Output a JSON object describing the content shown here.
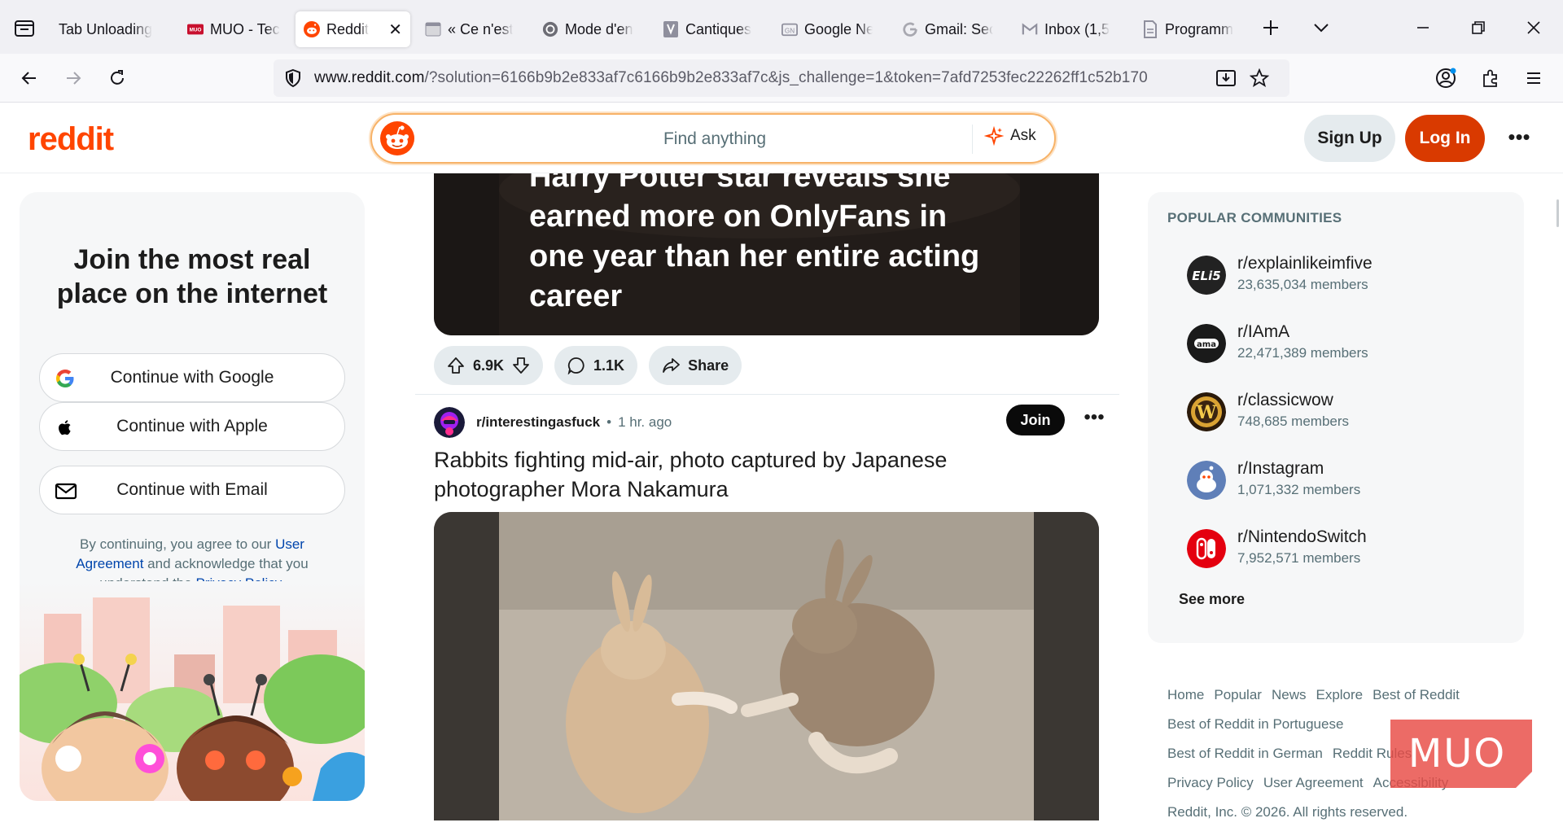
{
  "browser": {
    "tabs": [
      {
        "label": "Tab Unloading",
        "icon": "firefox-icon",
        "active": false
      },
      {
        "label": "MUO - Tec",
        "icon": "muo-icon",
        "active": false
      },
      {
        "label": "Reddit",
        "icon": "reddit-icon",
        "active": true
      },
      {
        "label": "« Ce n'est",
        "icon": "page-icon",
        "active": false
      },
      {
        "label": "Mode d'en",
        "icon": "swirl-icon",
        "active": false
      },
      {
        "label": "Cantiques",
        "icon": "drive-icon",
        "active": false
      },
      {
        "label": "Google Ne",
        "icon": "google-news-icon",
        "active": false
      },
      {
        "label": "Gmail: Sec",
        "icon": "google-icon",
        "active": false
      },
      {
        "label": "Inbox (1,5",
        "icon": "gmail-icon",
        "active": false
      },
      {
        "label": "Programm",
        "icon": "document-icon",
        "active": false
      }
    ],
    "url_host": "www.reddit.com",
    "url_rest": "/?solution=6166b9b2e833af7c6166b9b2e833af7c&js_challenge=1&token=7afd7253fec22262ff1c52b170"
  },
  "header": {
    "logo": "reddit",
    "search_placeholder": "Find anything",
    "ask_label": "Ask",
    "signup_label": "Sign Up",
    "login_label": "Log In",
    "more_label": "•••"
  },
  "join": {
    "title": "Join the most real place on the internet",
    "google_label": "Continue with Google",
    "apple_label": "Continue with Apple",
    "email_label": "Continue with Email",
    "legal_prefix": "By continuing, you agree to our ",
    "legal_link1": "User Agreement",
    "legal_mid": " and acknowledge that you understand the ",
    "legal_link2": "Privacy Policy",
    "legal_suffix": "."
  },
  "feed": {
    "post1": {
      "image_text": "Harry Potter star reveals she earned more on OnlyFans in one year than her entire acting career",
      "upvotes": "6.9K",
      "comments": "1.1K",
      "share_label": "Share"
    },
    "post2": {
      "subreddit": "r/interestingasfuck",
      "dot": "•",
      "time": "1 hr. ago",
      "join_label": "Join",
      "more_label": "•••",
      "title": "Rabbits fighting mid-air, photo captured by Japanese photographer Mora Nakamura"
    }
  },
  "sidebar": {
    "title": "POPULAR COMMUNITIES",
    "communities": [
      {
        "name": "r/explainlikeimfive",
        "members": "23,635,034 members",
        "avatar_text": "ELi5"
      },
      {
        "name": "r/IAmA",
        "members": "22,471,389 members",
        "avatar_text": "ama"
      },
      {
        "name": "r/classicwow",
        "members": "748,685 members",
        "avatar_text": "W"
      },
      {
        "name": "r/Instagram",
        "members": "1,071,332 members",
        "avatar_text": ""
      },
      {
        "name": "r/NintendoSwitch",
        "members": "7,952,571 members",
        "avatar_text": ""
      }
    ],
    "see_more": "See more",
    "footer_links": [
      "Home",
      "Popular",
      "News",
      "Explore",
      "Best of Reddit",
      "Best of Reddit in Portuguese",
      "Best of Reddit in German",
      "Reddit Rules",
      "Privacy Policy",
      "User Agreement",
      "Accessibility"
    ],
    "copyright": "Reddit, Inc. © 2026. All rights reserved."
  },
  "watermark": "MUO",
  "colors": {
    "brand": "#ff4500",
    "login": "#d93a00",
    "link": "#0045ac",
    "muted": "#576f76"
  }
}
